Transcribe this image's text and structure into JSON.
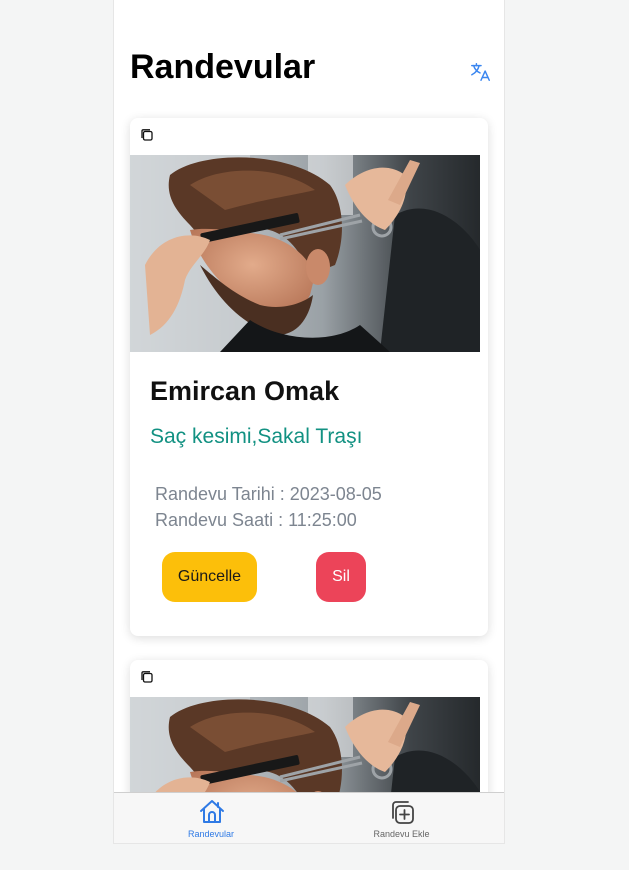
{
  "header": {
    "title": "Randevular",
    "translate_icon": "translate-icon"
  },
  "appointments": [
    {
      "copy_icon": "copy-icon",
      "image": "barber-haircut-photo",
      "customer_name": "Emircan Omak",
      "service": "Saç kesimi,Sakal Traşı",
      "date_text": "Randevu Tarihi : 2023-08-05",
      "time_text": "Randevu Saati : 11:25:00",
      "update_label": "Güncelle",
      "delete_label": "Sil"
    },
    {
      "copy_icon": "copy-icon",
      "image": "barber-haircut-photo"
    }
  ],
  "tabbar": {
    "tabs": [
      {
        "label": "Randevular",
        "icon": "home-icon",
        "active": true
      },
      {
        "label": "Randevu Ekle",
        "icon": "add-square-icon",
        "active": false
      }
    ]
  },
  "colors": {
    "accent": "#2f7ae5",
    "service_text": "#129182",
    "update_button": "#fcbf0a",
    "delete_button": "#ec4459",
    "info_text": "#7d8590"
  }
}
